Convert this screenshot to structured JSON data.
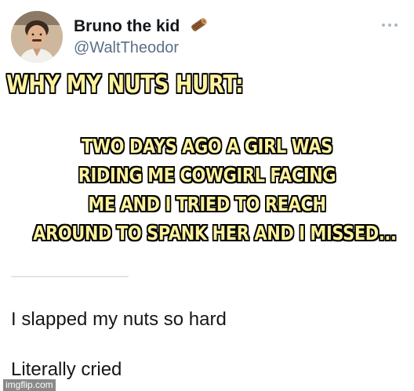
{
  "tweet": {
    "display_name": "Bruno the kid",
    "handle": "@WaltTheodor",
    "name_icon": "firewood-log-icon",
    "more_icon": "more-options-icon",
    "text_lines": [
      "I slapped my nuts so hard",
      "Literally cried"
    ]
  },
  "meme": {
    "heading": "WHY MY NUTS HURT:",
    "story_lines": [
      "TWO DAYS AGO A GIRL WAS",
      "RIDING  ME  COWGIRL FACING",
      "ME AND I TRIED TO REACH",
      "AROUND TO SPANK HER AND I MISSED..."
    ],
    "text_color": "#fff3a0",
    "outline_color": "#000000"
  },
  "watermark": "imgflip.com"
}
